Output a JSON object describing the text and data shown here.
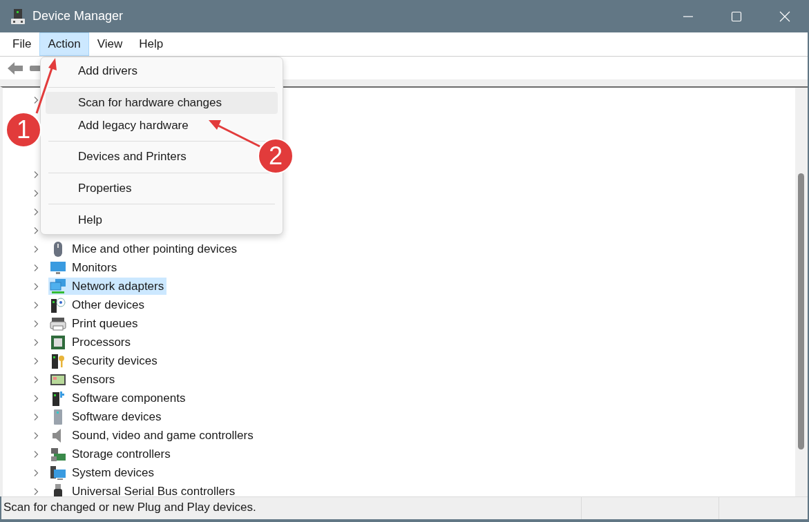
{
  "window": {
    "title": "Device Manager"
  },
  "menubar": [
    {
      "label": "File",
      "selected": false
    },
    {
      "label": "Action",
      "selected": true
    },
    {
      "label": "View",
      "selected": false
    },
    {
      "label": "Help",
      "selected": false
    }
  ],
  "tree": {
    "items": [
      {
        "expanded": false
      },
      {
        "expanded": false
      },
      {
        "expanded": false
      },
      {
        "expanded": false
      },
      {
        "expanded": false
      },
      {
        "label": "Mice and other pointing devices",
        "expanded": false,
        "selected": false
      },
      {
        "label": "Monitors",
        "expanded": false,
        "selected": false
      },
      {
        "label": "Network adapters",
        "expanded": false,
        "selected": true
      },
      {
        "label": "Other devices",
        "expanded": false,
        "selected": false
      },
      {
        "label": "Print queues",
        "expanded": false,
        "selected": false
      },
      {
        "label": "Processors",
        "expanded": false,
        "selected": false
      },
      {
        "label": "Security devices",
        "expanded": false,
        "selected": false
      },
      {
        "label": "Sensors",
        "expanded": false,
        "selected": false
      },
      {
        "label": "Software components",
        "expanded": false,
        "selected": false
      },
      {
        "label": "Software devices",
        "expanded": false,
        "selected": false
      },
      {
        "label": "Sound, video and game controllers",
        "expanded": false,
        "selected": false
      },
      {
        "label": "Storage controllers",
        "expanded": false,
        "selected": false
      },
      {
        "label": "System devices",
        "expanded": false,
        "selected": false
      },
      {
        "label": "Universal Serial Bus controllers",
        "expanded": false,
        "selected": false
      }
    ]
  },
  "action_menu": [
    {
      "kind": "item",
      "label": "Add drivers",
      "selected": false
    },
    {
      "kind": "separator"
    },
    {
      "kind": "item",
      "label": "Scan for hardware changes",
      "selected": true
    },
    {
      "kind": "item",
      "label": "Add legacy hardware",
      "selected": false
    },
    {
      "kind": "separator"
    },
    {
      "kind": "item",
      "label": "Devices and Printers",
      "selected": false
    },
    {
      "kind": "separator"
    },
    {
      "kind": "item",
      "label": "Properties",
      "selected": false
    },
    {
      "kind": "separator"
    },
    {
      "kind": "item",
      "label": "Help",
      "selected": false
    }
  ],
  "annotations": [
    {
      "label": "1"
    },
    {
      "label": "2"
    }
  ],
  "status_bar": {
    "text": "Scan for changed or new Plug and Play devices."
  }
}
